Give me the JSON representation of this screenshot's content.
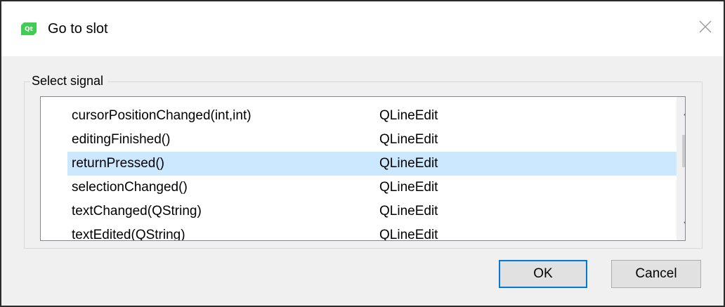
{
  "window": {
    "title": "Go to slot",
    "icon": "qt-designer-icon",
    "close_icon": "close-icon"
  },
  "group": {
    "label": "Select signal"
  },
  "signals": [
    {
      "signal": "cursorPositionChanged(int,int)",
      "class": "QLineEdit",
      "selected": false
    },
    {
      "signal": "editingFinished()",
      "class": "QLineEdit",
      "selected": false
    },
    {
      "signal": "returnPressed()",
      "class": "QLineEdit",
      "selected": true
    },
    {
      "signal": "selectionChanged()",
      "class": "QLineEdit",
      "selected": false
    },
    {
      "signal": "textChanged(QString)",
      "class": "QLineEdit",
      "selected": false
    },
    {
      "signal": "textEdited(QString)",
      "class": "QLineEdit",
      "selected": false
    }
  ],
  "scrollbar": {
    "up_icon": "chevron-up-icon",
    "down_icon": "chevron-down-icon"
  },
  "buttons": {
    "ok_label": "OK",
    "cancel_label": "Cancel"
  },
  "colors": {
    "selection": "#cce8ff",
    "default_button_border": "#0078d7",
    "qt_green": "#41cd52"
  }
}
